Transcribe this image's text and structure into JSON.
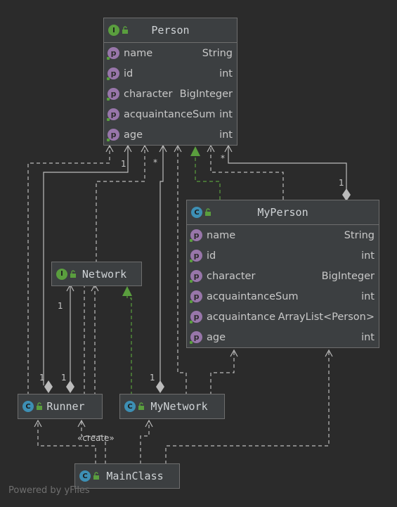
{
  "nodes": {
    "person": {
      "title": "Person",
      "kind": "I",
      "fields": [
        {
          "name": "name",
          "type": "String"
        },
        {
          "name": "id",
          "type": "int"
        },
        {
          "name": "character",
          "type": "BigInteger"
        },
        {
          "name": "acquaintanceSum",
          "type": "int"
        },
        {
          "name": "age",
          "type": "int"
        }
      ]
    },
    "myperson": {
      "title": "MyPerson",
      "kind": "C",
      "fields": [
        {
          "name": "name",
          "type": "String"
        },
        {
          "name": "id",
          "type": "int"
        },
        {
          "name": "character",
          "type": "BigInteger"
        },
        {
          "name": "acquaintanceSum",
          "type": "int"
        },
        {
          "name": "acquaintance",
          "type": "ArrayList<Person>"
        },
        {
          "name": "age",
          "type": "int"
        }
      ]
    },
    "network": {
      "title": "Network",
      "kind": "I"
    },
    "runner": {
      "title": "Runner",
      "kind": "C"
    },
    "mynetwork": {
      "title": "MyNetwork",
      "kind": "C"
    },
    "mainclass": {
      "title": "MainClass",
      "kind": "C"
    }
  },
  "field_badge": "p",
  "edge_labels": {
    "one_a": "1",
    "star_a": "*",
    "star_b": "*",
    "one_b": "1",
    "one_c": "1",
    "one_d": "1",
    "one_e": "1",
    "one_f": "1",
    "create": "«create»"
  },
  "footer": "Powered by yFiles",
  "colors": {
    "background": "#2b2b2b",
    "node": "#3c3f41",
    "border": "#6e6e6e",
    "edge": "#bbbbbb",
    "realization": "#5a9e3e",
    "interface_badge": "#5a9e3e",
    "class_badge": "#3d8fb4",
    "field_badge": "#9876aa"
  }
}
